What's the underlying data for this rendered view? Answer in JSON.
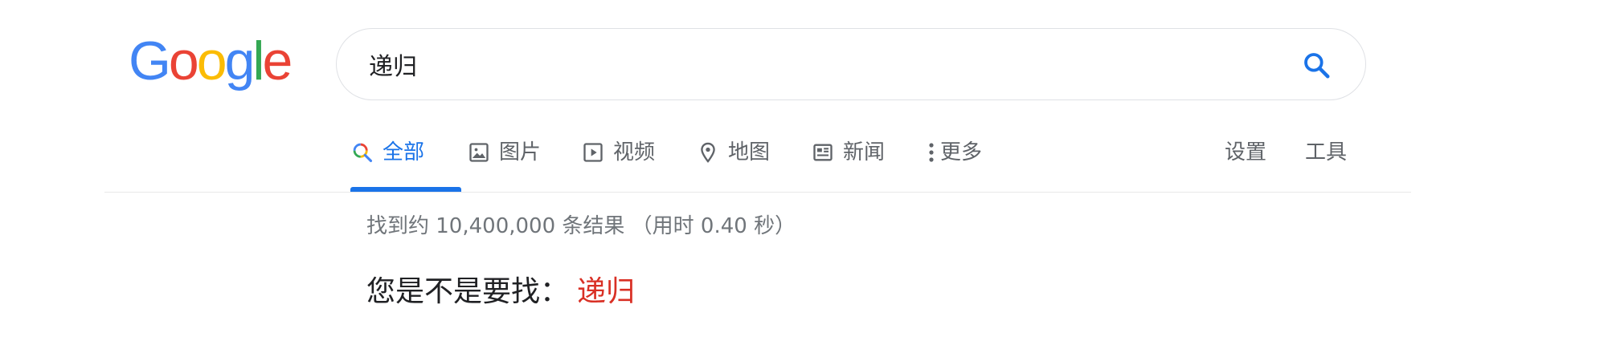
{
  "logo": {
    "letters": [
      {
        "char": "G",
        "color": "#4285F4"
      },
      {
        "char": "o",
        "color": "#EA4335"
      },
      {
        "char": "o",
        "color": "#FBBC05"
      },
      {
        "char": "g",
        "color": "#4285F4"
      },
      {
        "char": "l",
        "color": "#34A853"
      },
      {
        "char": "e",
        "color": "#EA4335"
      }
    ]
  },
  "search": {
    "value": "递归",
    "icon": "search-icon",
    "icon_color": "#1a73e8"
  },
  "tabs": [
    {
      "label": "全部",
      "icon": "search-multicolor-icon",
      "active": true
    },
    {
      "label": "图片",
      "icon": "image-icon",
      "active": false
    },
    {
      "label": "视频",
      "icon": "video-play-icon",
      "active": false
    },
    {
      "label": "地图",
      "icon": "map-pin-icon",
      "active": false
    },
    {
      "label": "新闻",
      "icon": "news-icon",
      "active": false
    },
    {
      "label": "更多",
      "icon": "more-vertical-icon",
      "active": false
    }
  ],
  "tools": {
    "settings_label": "设置",
    "tools_label": "工具"
  },
  "results": {
    "stats": "找到约 10,400,000 条结果 （用时 0.40 秒）"
  },
  "spelling": {
    "prompt": "您是不是要找：",
    "suggestion": "递归",
    "suggestion_color": "#d93025"
  },
  "colors": {
    "accent": "#1a73e8",
    "muted": "#5f6368"
  }
}
